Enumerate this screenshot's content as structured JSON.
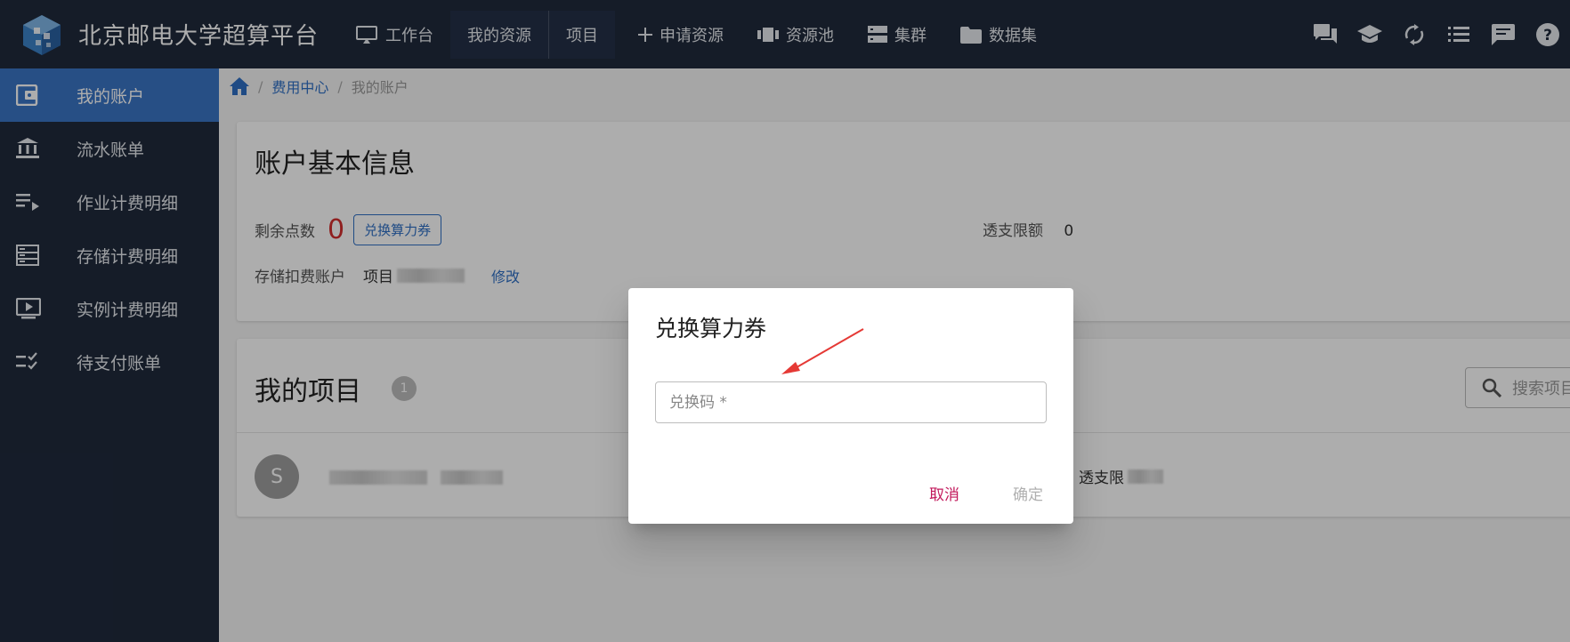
{
  "header": {
    "brand": "北京邮电大学超算平台",
    "nav": [
      {
        "label": "工作台",
        "icon": "monitor-icon"
      },
      {
        "label": "我的资源",
        "icon": ""
      },
      {
        "label": "项目",
        "icon": ""
      },
      {
        "label": "申请资源",
        "icon": "plus-icon"
      },
      {
        "label": "资源池",
        "icon": "resource-pool-icon"
      },
      {
        "label": "集群",
        "icon": "server-icon"
      },
      {
        "label": "数据集",
        "icon": "folder-icon"
      }
    ],
    "right_icons": [
      "forum-icon",
      "school-icon",
      "sync-icon",
      "list-icon",
      "message-icon",
      "help-icon"
    ]
  },
  "sidebar": {
    "items": [
      {
        "label": "我的账户",
        "icon": "wallet-icon",
        "active": true
      },
      {
        "label": "流水账单",
        "icon": "bank-icon",
        "active": false
      },
      {
        "label": "作业计费明细",
        "icon": "playlist-icon",
        "active": false
      },
      {
        "label": "存储计费明细",
        "icon": "storage-icon",
        "active": false
      },
      {
        "label": "实例计费明细",
        "icon": "instance-icon",
        "active": false
      },
      {
        "label": "待支付账单",
        "icon": "checklist-icon",
        "active": false
      }
    ]
  },
  "breadcrumb": {
    "parent": "费用中心",
    "current": "我的账户"
  },
  "account": {
    "title": "账户基本信息",
    "points_label": "剩余点数",
    "points_value": "0",
    "redeem_button": "兑换算力券",
    "overdraft_label": "透支限额",
    "overdraft_value": "0",
    "storage_account_label": "存储扣费账户",
    "storage_account_prefix": "项目",
    "edit_link": "修改"
  },
  "projects": {
    "title": "我的项目",
    "count": "1",
    "search_placeholder": "搜索项目名",
    "rows": [
      {
        "avatar": "S",
        "overdraft_label": "透支限"
      }
    ]
  },
  "dialog": {
    "title": "兑换算力券",
    "field_placeholder": "兑换码 *",
    "field_value": "",
    "cancel": "取消",
    "confirm": "确定"
  },
  "colors": {
    "header_bg": "#1f2a3c",
    "active_item": "#3a75c4",
    "link": "#2f6fc4",
    "points": "#d32f2f",
    "cancel": "#c2185b",
    "annotation_arrow": "#e53935"
  }
}
